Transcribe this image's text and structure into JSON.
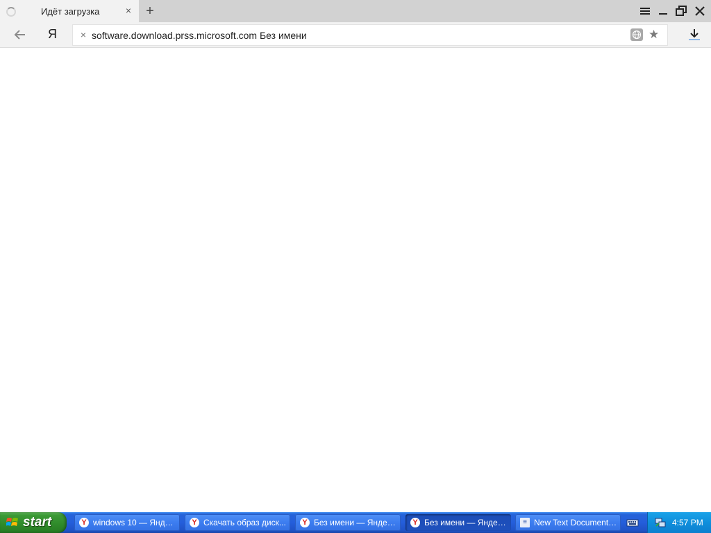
{
  "browser": {
    "tab": {
      "title": "Идёт загрузка",
      "close": "×"
    },
    "new_tab": "+",
    "home_logo": "Я",
    "address": {
      "stop": "×",
      "url": "software.download.prss.microsoft.com Без имени"
    },
    "icons": {
      "spinner": "loading-spinner-icon",
      "menu": "menu-icon",
      "minimize": "minimize-icon",
      "restore": "restore-icon",
      "close": "close-icon",
      "back": "back-arrow-icon",
      "globe": "globe-icon",
      "star": "star-icon",
      "downloads": "download-icon"
    }
  },
  "taskbar": {
    "start_label": "start",
    "tasks": [
      {
        "label": "windows 10 — Янде...",
        "icon": "Y",
        "active": false
      },
      {
        "label": "Скачать образ диск...",
        "icon": "Y",
        "active": false
      },
      {
        "label": "Без имени — Яндек...",
        "icon": "Y",
        "active": false
      },
      {
        "label": "Без имени — Яндек...",
        "icon": "Y",
        "active": true
      },
      {
        "label": "New Text Document ...",
        "icon": "≡",
        "active": false
      }
    ],
    "clock": "4:57 PM"
  },
  "colors": {
    "tabstrip": "#d2d2d2",
    "toolbar": "#f2f2f2",
    "taskbar_blue": "#245edb",
    "start_green": "#3c9a36",
    "tray_blue": "#0f8fdc"
  }
}
